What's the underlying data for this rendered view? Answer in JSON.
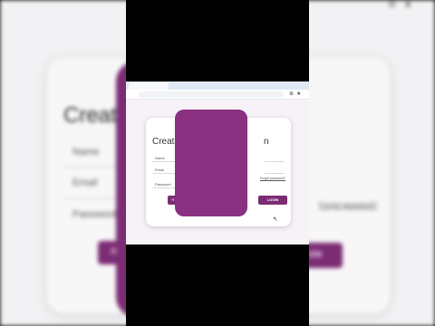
{
  "background": {
    "title_partial": "Creat",
    "labels": [
      "Name",
      "Email",
      "Password"
    ],
    "left_button_partial": "R",
    "right_button_partial": "GN",
    "forgot_link": "Forgot password?",
    "toolbar_icons": [
      "gear-icon",
      "star-icon"
    ]
  },
  "browser": {
    "tab_label": "",
    "address": ""
  },
  "form": {
    "title_left": "Create",
    "title_right": "n",
    "fields": [
      {
        "placeholder": "Name"
      },
      {
        "placeholder": "Email"
      },
      {
        "placeholder": "Password"
      }
    ],
    "forgot_link": "Forgot password?",
    "create_button": "R",
    "login_button": "LOGIN"
  },
  "colors": {
    "accent": "#7b2c74",
    "panel": "#8a3080",
    "page_bg": "#f7f2f8"
  }
}
